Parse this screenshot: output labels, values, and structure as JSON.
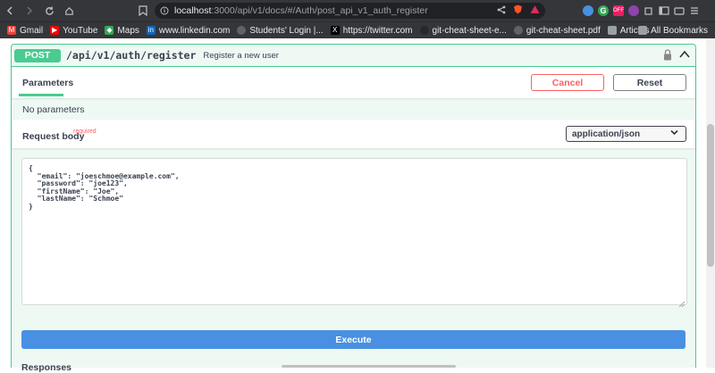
{
  "browser": {
    "url_host": "localhost",
    "url_rest": ":3000/api/v1/docs/#/Auth/post_api_v1_auth_register",
    "bookmarks": [
      {
        "label": "Gmail",
        "icon": "gmail-icon",
        "color": "#ea4335"
      },
      {
        "label": "YouTube",
        "icon": "youtube-icon",
        "color": "#ff0000"
      },
      {
        "label": "Maps",
        "icon": "maps-icon",
        "color": "#34a853"
      },
      {
        "label": "www.linkedin.com",
        "icon": "linkedin-icon",
        "color": "#0a66c2"
      },
      {
        "label": "Students' Login |...",
        "icon": "globe-icon",
        "color": "#5f6368"
      },
      {
        "label": "https://twitter.com",
        "icon": "x-icon",
        "color": "#000000"
      },
      {
        "label": "git-cheat-sheet-e...",
        "icon": "github-icon",
        "color": "#24292e"
      },
      {
        "label": "git-cheat-sheet.pdf",
        "icon": "globe-icon",
        "color": "#5f6368"
      },
      {
        "label": "Articles",
        "icon": "folder-icon",
        "color": "#9aa0a6"
      }
    ],
    "all_bookmarks": "All Bookmarks"
  },
  "operation": {
    "method": "POST",
    "path": "/api/v1/auth/register",
    "summary": "Register a new user"
  },
  "parameters": {
    "tab_label": "Parameters",
    "cancel_label": "Cancel",
    "reset_label": "Reset",
    "empty_text": "No parameters"
  },
  "request_body": {
    "title": "Request body",
    "required_label": "required",
    "content_type": "application/json",
    "body": "{\n  \"email\": \"joeschmoe@example.com\",\n  \"password\": \"joe123\",\n  \"firstName\": \"Joe\",\n  \"lastName\": \"Schmoe\"\n}"
  },
  "execute_label": "Execute",
  "responses_label": "Responses",
  "colors": {
    "post_green": "#49cc90",
    "execute_blue": "#4990e2",
    "cancel_red": "#ff6060"
  }
}
